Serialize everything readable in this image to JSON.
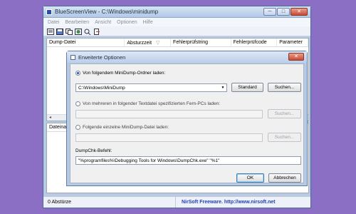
{
  "window": {
    "title": "BlueScreenView  -  C:\\Windows\\minidump",
    "minimize": "─",
    "maximize": "□",
    "close": "✕"
  },
  "menu": [
    "Datei",
    "Bearbeiten",
    "Ansicht",
    "Optionen",
    "Hilfe"
  ],
  "toolbar": {
    "icons": [
      "properties-icon",
      "save-icon",
      "copy-icon",
      "html-report-icon",
      "search-icon",
      "exit-icon"
    ]
  },
  "list": {
    "columns": [
      "Dump-Datei",
      "Absturzzeit",
      "Fehlerprüfstring",
      "Fehlerprüfcode",
      "Parameter"
    ]
  },
  "lower_pane": {
    "column": "Dateina"
  },
  "status": {
    "count": "0 Abstürze",
    "link": "NirSoft Freeware.  http://www.nirsoft.net"
  },
  "dialog": {
    "title": "Erweiterte Optionen",
    "close": "✕",
    "option1": {
      "label": "Von folgendem MiniDump-Ordner laden:",
      "value": "C:\\Windows\\MiniDump",
      "standard_button": "Standard",
      "browse_button": "Suchen..."
    },
    "option2": {
      "label": "Von mehreren in folgender Textdatei spezifizierten Fern-PCs laden:",
      "value": "",
      "browse_button": "Suchen..."
    },
    "option3": {
      "label": "Folgende einzelne MiniDump-Datei laden:",
      "value": "",
      "browse_button": "Suchen..."
    },
    "dumpchk": {
      "label": "DumpChk-Befehl:",
      "value": "\"%programfiles%\\Debugging Tools for Windows\\DumpChk.exe\" \"%1\""
    },
    "ok_button": "OK",
    "cancel_button": "Abbrechen"
  }
}
